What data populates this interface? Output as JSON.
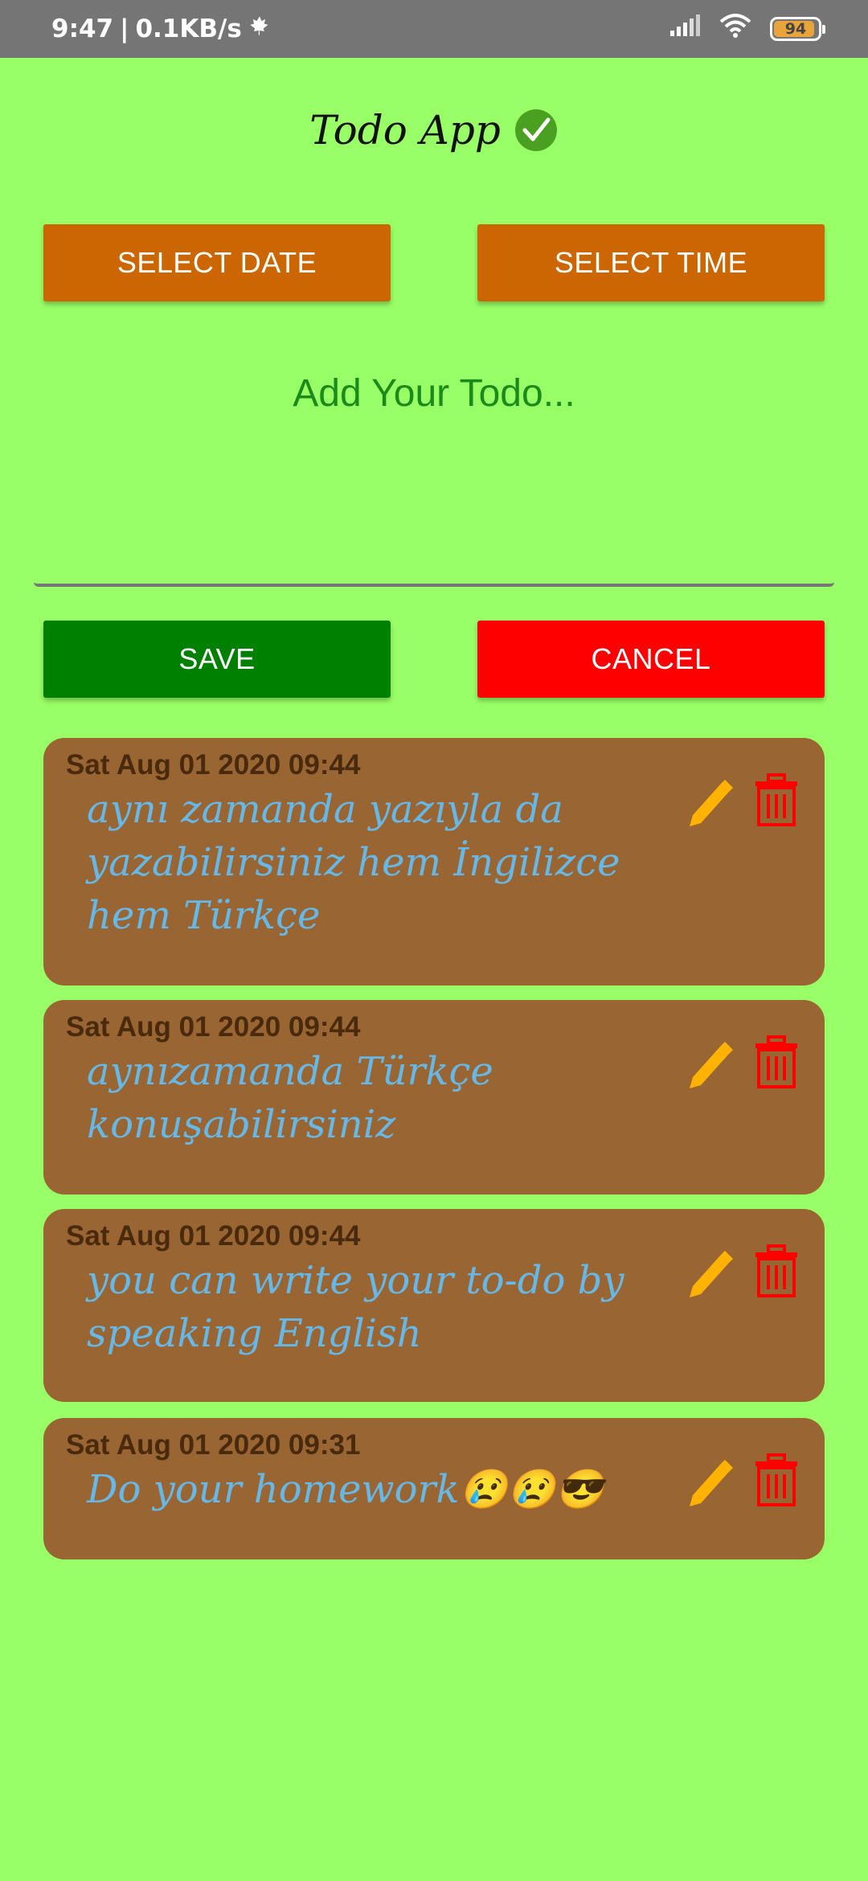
{
  "status": {
    "time": "9:47",
    "speed": "0.1KB/s",
    "battery": "94"
  },
  "app": {
    "title": "Todo App",
    "select_date": "SELECT DATE",
    "select_time": "SELECT TIME",
    "input_placeholder": "Add Your Todo...",
    "save": "SAVE",
    "cancel": "CANCEL"
  },
  "todos": [
    {
      "date": "Sat Aug 01 2020 09:44",
      "text": "aynı zamanda yazıyla da yazabilirsiniz hem İngilizce hem Türkçe"
    },
    {
      "date": "Sat Aug 01 2020 09:44",
      "text": "aynızamanda Türkçe konuşabilirsiniz"
    },
    {
      "date": "Sat Aug 01 2020 09:44",
      "text": "you can write your to-do by speaking English"
    },
    {
      "date": "Sat Aug 01 2020 09:31",
      "text": "Do your homework😢😢😎"
    }
  ],
  "colors": {
    "background": "#99ff66",
    "accent_orange": "#cc6600",
    "save_green": "#008000",
    "cancel_red": "#ff0000",
    "card_brown": "#996633",
    "todo_text_blue": "#66b8e8",
    "edit_icon": "#ffb300",
    "delete_icon": "#ff0000"
  },
  "icons": [
    "check-icon",
    "edit-icon",
    "trash-icon",
    "signal-icon",
    "wifi-icon",
    "battery-icon",
    "leaf-icon"
  ]
}
